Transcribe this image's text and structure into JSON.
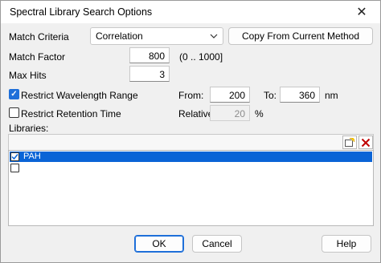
{
  "window": {
    "title": "Spectral Library Search Options",
    "close_glyph": "✕"
  },
  "match_criteria": {
    "label": "Match Criteria",
    "selected": "Correlation",
    "copy_button_label": "Copy From Current Method"
  },
  "match_factor": {
    "label": "Match Factor",
    "value": "800",
    "range_hint": "(0 .. 1000]"
  },
  "max_hits": {
    "label": "Max Hits",
    "value": "3"
  },
  "restrict_wavelength": {
    "label": "Restrict Wavelength Range",
    "checked": true,
    "from_label": "From:",
    "from_value": "200",
    "to_label": "To:",
    "to_value": "360",
    "unit": "nm"
  },
  "restrict_retention": {
    "label": "Restrict Retention Time",
    "checked": false,
    "relative_label": "Relative:",
    "relative_value": "20",
    "unit": "%"
  },
  "libraries": {
    "label": "Libraries:",
    "items": [
      {
        "name": "PAH",
        "checked": true,
        "selected": true
      },
      {
        "name": "",
        "checked": false,
        "selected": false
      }
    ]
  },
  "buttons": {
    "ok": "OK",
    "cancel": "Cancel",
    "help": "Help"
  },
  "colors": {
    "accent": "#0a64d6",
    "delete_icon": "#c00000"
  }
}
